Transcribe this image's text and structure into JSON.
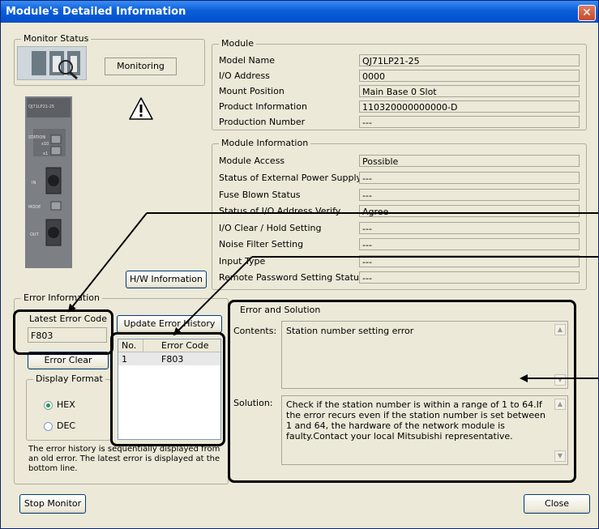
{
  "window": {
    "title": "Module's Detailed Information",
    "close_symbol": "✕"
  },
  "monitor_status": {
    "group_title": "Monitor Status",
    "status": "Monitoring"
  },
  "module": {
    "group_title": "Module",
    "fields": [
      {
        "label": "Model Name",
        "value": "QJ71LP21-25"
      },
      {
        "label": "I/O Address",
        "value": "0000"
      },
      {
        "label": "Mount Position",
        "value": "Main Base  0 Slot"
      },
      {
        "label": "Product Information",
        "value": "110320000000000-D"
      },
      {
        "label": "Production Number",
        "value": "---"
      }
    ]
  },
  "module_info": {
    "group_title": "Module Information",
    "fields": [
      {
        "label": "Module Access",
        "value": "Possible"
      },
      {
        "label": "Status of External Power Supply",
        "value": "---"
      },
      {
        "label": "Fuse Blown Status",
        "value": "---"
      },
      {
        "label": "Status of I/O Address Verify",
        "value": "Agree"
      },
      {
        "label": "I/O Clear / Hold Setting",
        "value": "---"
      },
      {
        "label": "Noise Filter Setting",
        "value": "---"
      },
      {
        "label": "Input Type",
        "value": "---"
      },
      {
        "label": "Remote Password Setting Status",
        "value": "---"
      }
    ]
  },
  "hw_info_button": "H/W Information",
  "error_info": {
    "group_title": "Error Information",
    "latest_error_label": "Latest Error Code",
    "latest_error_value": "F803",
    "update_history_button": "Update Error History",
    "error_clear_button": "Error Clear",
    "history_headers": [
      "No.",
      "Error Code"
    ],
    "history_rows": [
      {
        "no": "1",
        "code": "F803"
      }
    ],
    "display_format": {
      "group_title": "Display Format",
      "options": [
        "HEX",
        "DEC"
      ],
      "selected": "HEX"
    },
    "note": "The error history is sequentially displayed from an old error. The latest error is displayed at the bottom line."
  },
  "error_solution": {
    "group_title": "Error and Solution",
    "contents_label": "Contents:",
    "contents": "Station number setting error",
    "solution_label": "Solution:",
    "solution": "Check if the station number is within a range of 1 to 64.If the error recurs even if the station number is set between 1 and 64, the hardware of the network module is faulty.Contact your local Mitsubishi representative."
  },
  "footer": {
    "stop_monitor_button": "Stop Monitor",
    "close_button": "Close"
  },
  "module_image": {
    "top_label": "QJ71LP21-25",
    "status_labels": [
      "STATION",
      "x10",
      "x1"
    ],
    "port_labels": [
      "IN",
      "MODE",
      "OUT"
    ]
  }
}
